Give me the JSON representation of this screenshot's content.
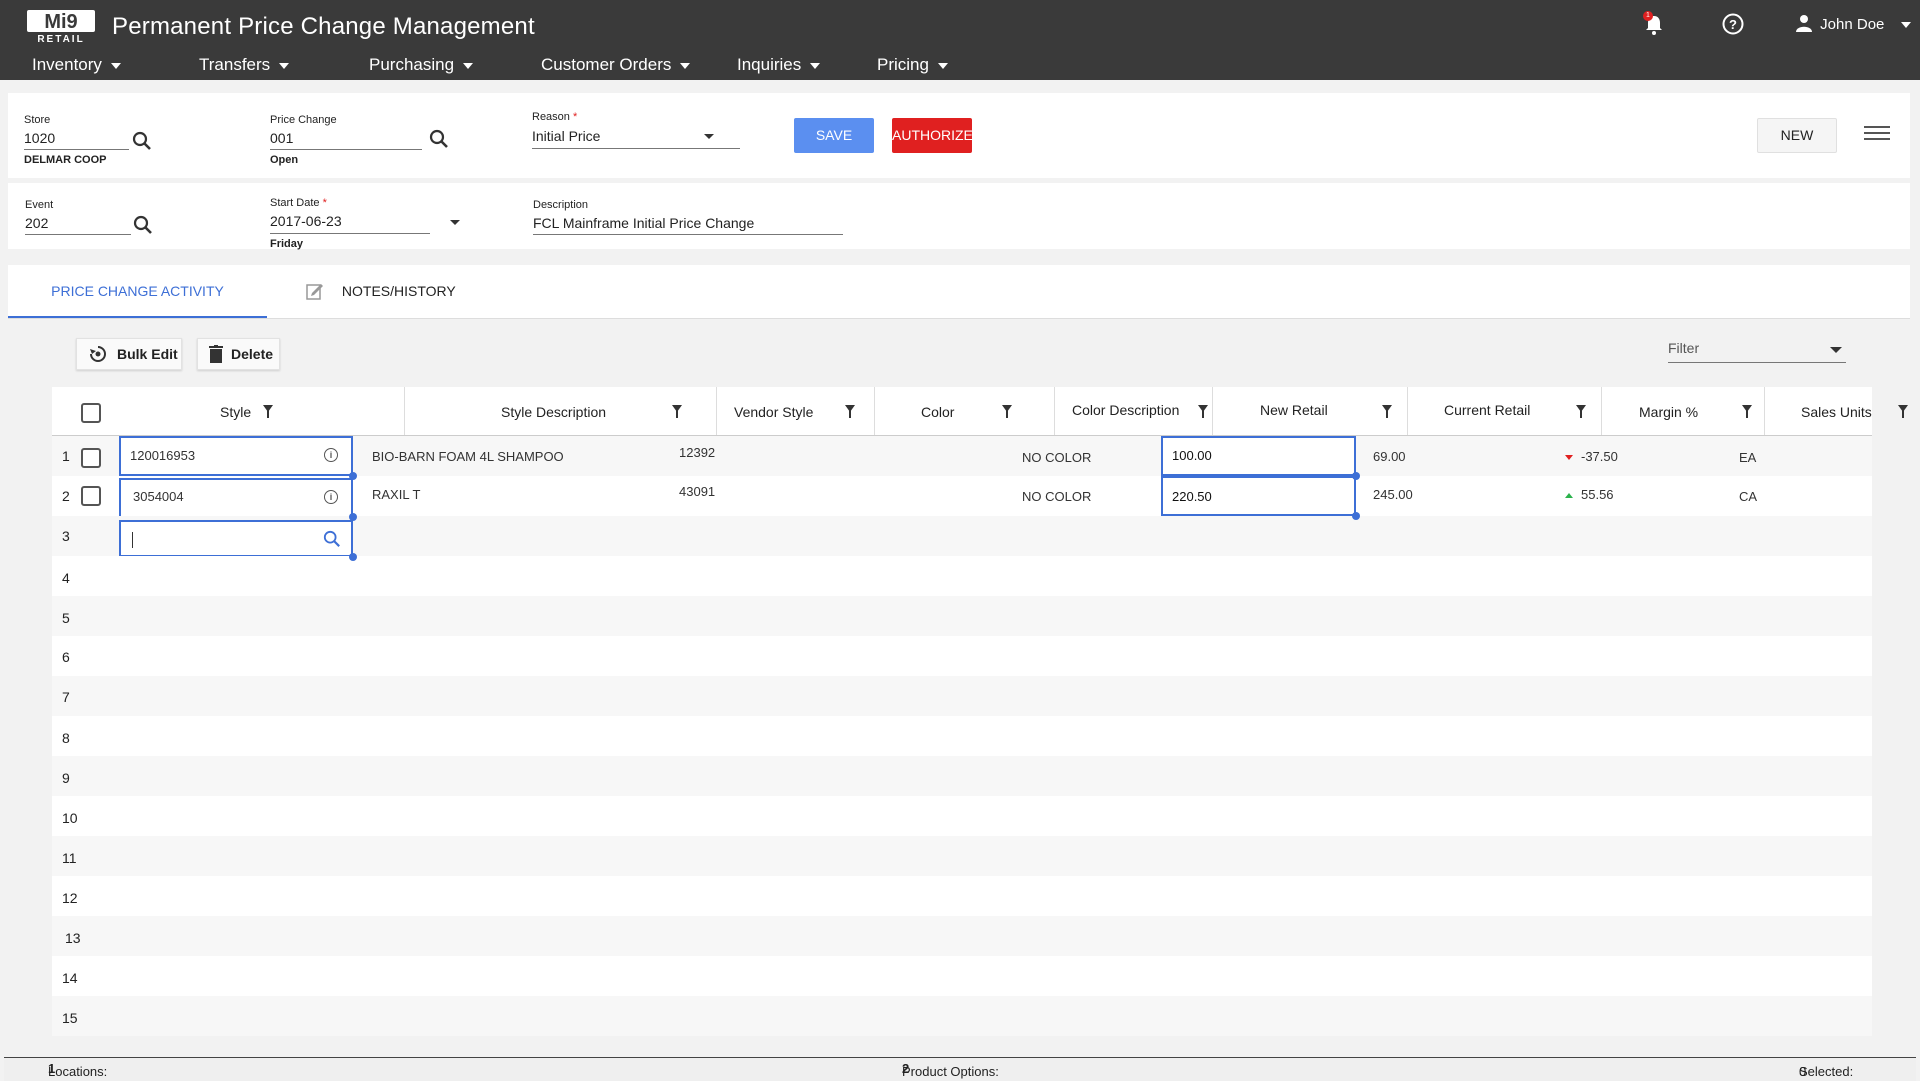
{
  "app": {
    "logo_text": "Mi9 RETAIL",
    "title": "Permanent Price Change Management",
    "notification_count": "1",
    "user_name": "John Doe"
  },
  "nav": [
    "Inventory",
    "Transfers",
    "Purchasing",
    "Customer Orders",
    "Inquiries",
    "Pricing"
  ],
  "header_form": {
    "store_label": "Store",
    "store_value": "1020",
    "store_name": "DELMAR COOP",
    "price_change_label": "Price Change",
    "price_change_value": "001",
    "price_change_status": "Open",
    "reason_label": "Reason",
    "reason_value": "Initial Price",
    "save_label": "SAVE",
    "authorize_label": "AUTHORIZE",
    "new_label": "NEW",
    "event_label": "Event",
    "event_value": "202",
    "start_date_label": "Start Date",
    "start_date_value": "2017-06-23",
    "start_day": "Friday",
    "description_label": "Description",
    "description_value": "FCL Mainframe Initial Price Change"
  },
  "tabs": [
    "PRICE CHANGE ACTIVITY",
    "NOTES/HISTORY"
  ],
  "toolbar": {
    "bulk_edit_label": "Bulk Edit",
    "delete_label": "Delete",
    "filter_placeholder": "Filter"
  },
  "grid": {
    "columns": [
      "Style",
      "Style Description",
      "Vendor Style",
      "Color",
      "Color Description",
      "New Retail",
      "Current Retail",
      "Margin %",
      "Sales Units"
    ],
    "rows": [
      {
        "num": "1",
        "style": "120016953",
        "style_description": "BIO-BARN FOAM 4L SHAMPOO",
        "vendor_style": "12392",
        "color": "",
        "color_description": "NO COLOR",
        "new_retail": "100.00",
        "current_retail": "69.00",
        "margin": "-37.50",
        "margin_trend": "down",
        "sales_units": "EA"
      },
      {
        "num": "2",
        "style": "3054004",
        "style_description": "RAXIL T",
        "vendor_style": "43091",
        "color": "",
        "color_description": "NO COLOR",
        "new_retail": "220.50",
        "current_retail": "245.00",
        "margin": "55.56",
        "margin_trend": "up",
        "sales_units": "CA"
      }
    ],
    "empty_rows": [
      "3",
      "4",
      "5",
      "6",
      "7",
      "8",
      "9",
      "10",
      "11",
      "12",
      "13",
      "14",
      "15"
    ]
  },
  "footer": {
    "locations_label": "Locations:",
    "locations_value": "1",
    "product_options_label": "Product Options:",
    "product_options_value": "2",
    "selected_label": "Selected:",
    "selected_value": "0"
  },
  "colors": {
    "topbar": "#3a3a3a",
    "accent": "#3d6fd6",
    "save": "#5b8ff0",
    "authorize": "#e02020",
    "margin_down": "#e02020",
    "margin_up": "#2bb24c"
  }
}
